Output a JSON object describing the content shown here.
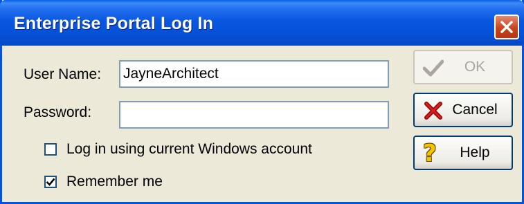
{
  "window": {
    "title": "Enterprise Portal Log In",
    "close_icon": "close-icon"
  },
  "form": {
    "username_label": "User Name:",
    "username_value": "JayneArchitect",
    "password_label": "Password:",
    "password_value": ""
  },
  "options": {
    "windows_account_label": "Log in using current Windows account",
    "windows_account_checked": false,
    "remember_me_label": "Remember me",
    "remember_me_checked": true
  },
  "buttons": {
    "ok_label": "OK",
    "ok_enabled": false,
    "ok_icon": "checkmark-icon",
    "cancel_label": "Cancel",
    "cancel_icon": "red-x-icon",
    "help_label": "Help",
    "help_icon": "question-mark-icon"
  },
  "colors": {
    "title_bar": "#0a58e0",
    "window_face": "#ece9d8",
    "close_button": "#c8431d",
    "field_border": "#7f9db9"
  }
}
